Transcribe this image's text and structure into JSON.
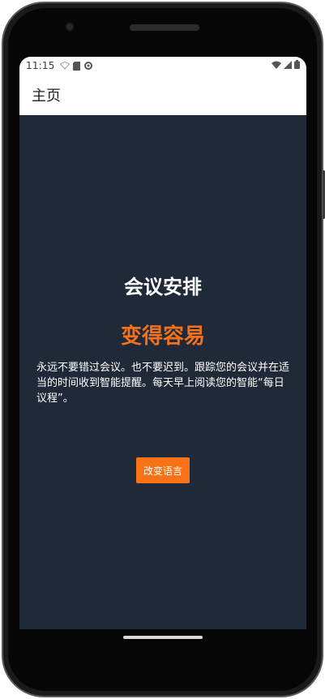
{
  "status_bar": {
    "time": "11:15",
    "left_icons": [
      "wifi-outline-icon",
      "sd-card-icon",
      "settings-icon"
    ],
    "right_icons": [
      "wifi-icon",
      "signal-icon",
      "battery-icon"
    ]
  },
  "app_bar": {
    "title": "主页"
  },
  "main": {
    "title": "会议安排",
    "subtitle": "变得容易",
    "description": "永远不要错过会议。也不要迟到。跟踪您的会议并在适当的时间收到智能提醒。每天早上阅读您的智能“每日议程”。",
    "change_language_button": "改变语言"
  },
  "colors": {
    "background": "#1f2937",
    "accent": "#f97316",
    "subtitle": "#f2711c",
    "app_bar": "#ffffff"
  }
}
